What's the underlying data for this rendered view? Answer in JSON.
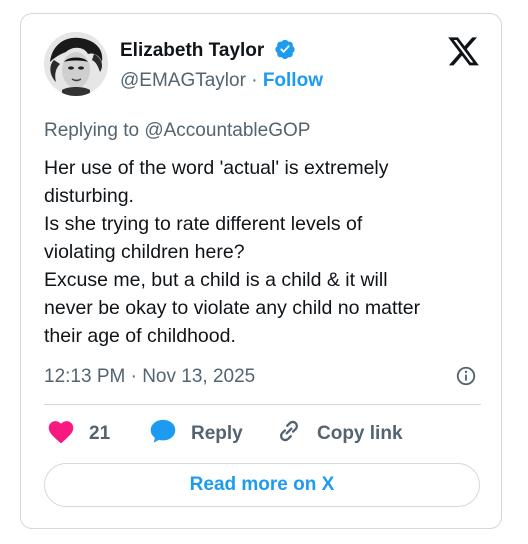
{
  "author": {
    "name": "Elizabeth Taylor",
    "handle": "@EMAGTaylor",
    "separator": "·",
    "follow_label": "Follow"
  },
  "reply_context": {
    "prefix": "Replying to ",
    "mention": "@AccountableGOP"
  },
  "tweet": {
    "lines": [
      "Her use of the word 'actual' is extremely",
      "disturbing.",
      "Is she trying to rate different levels of",
      "violating children here?",
      "Excuse me, but a child is a child & it will",
      "never be okay to violate any child no matter",
      "their age of childhood."
    ],
    "timestamp": "12:13 PM · Nov 13, 2025"
  },
  "actions": {
    "like_count": "21",
    "reply_label": "Reply",
    "copy_label": "Copy link"
  },
  "footer": {
    "read_more_label": "Read more on X"
  },
  "colors": {
    "accent": "#1d9bf0",
    "like": "#f91880",
    "secondary_text": "#536471",
    "border": "#cfd9de"
  },
  "icons": [
    "verified-badge-icon",
    "x-logo-icon",
    "info-icon",
    "heart-icon",
    "reply-bubble-icon",
    "link-icon"
  ]
}
